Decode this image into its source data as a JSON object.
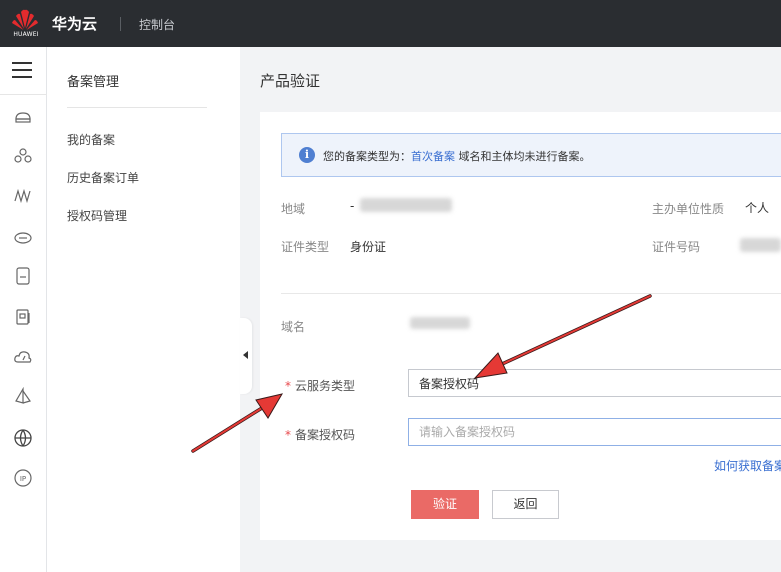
{
  "topbar": {
    "logo_text": "HUAWEI",
    "brand": "华为云",
    "console": "控制台"
  },
  "icon_bar": {
    "icons": [
      "menu-icon",
      "cloud-server-icon",
      "cluster-icon",
      "monitor-wave-icon",
      "cloud-disk-icon",
      "database-icon",
      "document-icon",
      "cloud-upload-icon",
      "sail-icon",
      "globe-www-icon",
      "ip-icon"
    ]
  },
  "sidebar": {
    "title": "备案管理",
    "items": [
      {
        "label": "我的备案"
      },
      {
        "label": "历史备案订单"
      },
      {
        "label": "授权码管理"
      }
    ]
  },
  "main": {
    "page_title": "产品验证",
    "alert": {
      "prefix": "您的备案类型为：",
      "link": "首次备案",
      "suffix": " 域名和主体均未进行备案。"
    },
    "info": {
      "region_label": "地域",
      "region_value": "-",
      "org_type_label": "主办单位性质",
      "org_type_value": "个人",
      "id_type_label": "证件类型",
      "id_type_value": "身份证",
      "id_number_label": "证件号码",
      "domain_label": "域名"
    },
    "form": {
      "service_type_label": "云服务类型",
      "service_type_value": "备案授权码",
      "auth_code_label": "备案授权码",
      "auth_code_placeholder": "请输入备案授权码",
      "help_link": "如何获取备案"
    },
    "buttons": {
      "verify": "验证",
      "back": "返回"
    }
  },
  "colors": {
    "topbar": "#2a2d31",
    "primary_button": "#ea6a66",
    "link": "#3a6fd1",
    "required_star": "#e8484c",
    "annotation_arrow": "#e53935"
  }
}
